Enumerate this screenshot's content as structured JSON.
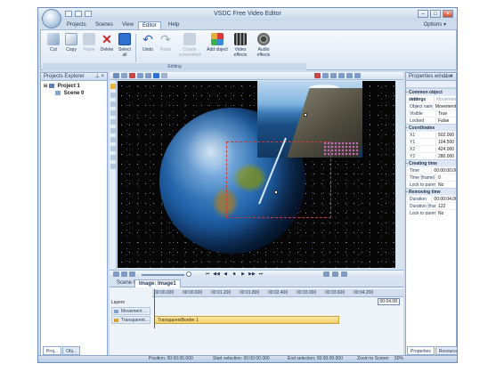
{
  "window": {
    "title": "VSDC Free Video Editor"
  },
  "menu": {
    "tabs": [
      "Projects",
      "Scenes",
      "View",
      "Editor",
      "Help"
    ],
    "active": "Editor",
    "options": "Options"
  },
  "ribbon": {
    "buttons": [
      "Cut",
      "Copy",
      "Paste",
      "Delete",
      "Select all",
      "Undo",
      "Redo",
      "Create screenshot",
      "Add object",
      "Video effects",
      "Audio effects"
    ],
    "group_label": "Editing"
  },
  "projects_explorer": {
    "title": "Projects Explorer",
    "project": "Project 1",
    "scene": "Scene 0",
    "bottom_tabs": [
      "Proj...",
      "Obj..."
    ]
  },
  "editor": {
    "doc_tabs": [
      "Scene 0",
      "Image: Image1"
    ],
    "ruler": [
      "00:00.000",
      "00:00.600",
      "00:01.200",
      "00:01.800",
      "00:02.400",
      "00:03.000",
      "00:03.600",
      "00:04.200"
    ],
    "layers_label": "Layers",
    "tracks": [
      {
        "name": "Movement ..."
      },
      {
        "name": "Transparent..."
      }
    ],
    "clip_label": "TransparentBorder 1",
    "time_badge": "00:04.08"
  },
  "properties": {
    "title": "Properties window",
    "sections": [
      {
        "name": "Common object settings",
        "rows": [
          {
            "k": "Type",
            "v": "Movement",
            "dim": true
          },
          {
            "k": "Object name",
            "v": "Movement1"
          },
          {
            "k": "Visible",
            "v": "True"
          },
          {
            "k": "Locked",
            "v": "False"
          }
        ]
      },
      {
        "name": "Coordinates",
        "rows": [
          {
            "k": "X1",
            "v": "502.000"
          },
          {
            "k": "Y1",
            "v": "104.500"
          },
          {
            "k": "X2",
            "v": "424.000"
          },
          {
            "k": "Y2",
            "v": "280.000"
          }
        ]
      },
      {
        "name": "Creating time",
        "rows": [
          {
            "k": "Time",
            "v": "00:00:00.000"
          },
          {
            "k": "Time (frame)",
            "v": "0"
          },
          {
            "k": "Lock to parent",
            "v": "No"
          }
        ]
      },
      {
        "name": "Removing time",
        "rows": [
          {
            "k": "Duration",
            "v": "00:00:04.066"
          },
          {
            "k": "Duration (frar",
            "v": "122"
          },
          {
            "k": "Lock to parent",
            "v": "No"
          }
        ]
      }
    ],
    "bottom_tabs": [
      "Properties ...",
      "Resources ..."
    ]
  },
  "status": {
    "position": "Position:  00:00:00.000",
    "start": "Start selection:  00:00:00.000",
    "end": "End selection:  00:00:00.000",
    "zoom": "Zoom to Screen",
    "zoom_value": "50%"
  },
  "colors": {
    "accent": "#6e8fb8",
    "clip": "#f3cf63",
    "selection": "#c33c3c"
  }
}
